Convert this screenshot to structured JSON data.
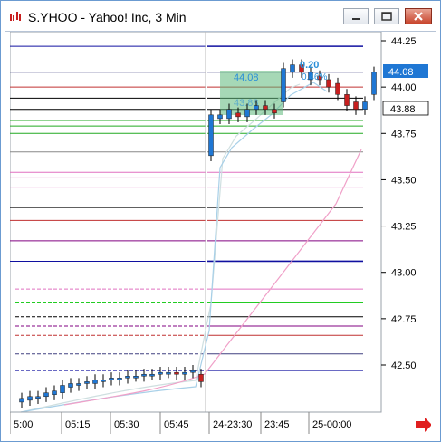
{
  "window": {
    "title": "S.YHOO - Yahoo! Inc, 3 Min"
  },
  "price_axis": {
    "ticks": [
      "44.25",
      "44.00",
      "43.75",
      "43.50",
      "43.25",
      "43.00",
      "42.75",
      "42.50"
    ],
    "last_price": "44.08",
    "bid_price": "43.88"
  },
  "time_axis": {
    "labels": [
      "5:00",
      "05:15",
      "05:30",
      "05:45",
      "24-23:30",
      "23:45",
      "25-00:00"
    ]
  },
  "annotations": {
    "box_price": "44.08",
    "box_price2": "43.88",
    "tooltip_value": "0.20",
    "tooltip_pct": "0.46%"
  },
  "colors": {
    "up_candle": "#1f77d4",
    "down_candle": "#c82020",
    "highlight_box": "#5cb87a",
    "last_price_badge": "#1f77d4"
  },
  "chart_data": {
    "type": "candlestick",
    "instrument": "S.YHOO",
    "interval": "3 Min",
    "ylim": [
      42.32,
      44.28
    ],
    "candles_left": [
      {
        "o": 42.3,
        "c": 42.32
      },
      {
        "o": 42.31,
        "c": 42.33
      },
      {
        "o": 42.32,
        "c": 42.33
      },
      {
        "o": 42.33,
        "c": 42.35
      },
      {
        "o": 42.34,
        "c": 42.36
      },
      {
        "o": 42.35,
        "c": 42.39
      },
      {
        "o": 42.38,
        "c": 42.4
      },
      {
        "o": 42.39,
        "c": 42.4
      },
      {
        "o": 42.4,
        "c": 42.41
      },
      {
        "o": 42.4,
        "c": 42.42
      },
      {
        "o": 42.41,
        "c": 42.42
      },
      {
        "o": 42.42,
        "c": 42.43
      },
      {
        "o": 42.42,
        "c": 42.43
      },
      {
        "o": 42.43,
        "c": 42.44
      },
      {
        "o": 42.44,
        "c": 42.44
      },
      {
        "o": 42.44,
        "c": 42.45
      },
      {
        "o": 42.45,
        "c": 42.45
      },
      {
        "o": 42.45,
        "c": 42.46
      },
      {
        "o": 42.46,
        "c": 42.46
      },
      {
        "o": 42.46,
        "c": 42.45
      },
      {
        "o": 42.45,
        "c": 42.46
      },
      {
        "o": 42.46,
        "c": 42.47
      },
      {
        "o": 42.45,
        "c": 42.41
      }
    ],
    "candles_right": [
      {
        "o": 43.63,
        "c": 43.85
      },
      {
        "o": 43.83,
        "c": 43.85
      },
      {
        "o": 43.83,
        "c": 43.88
      },
      {
        "o": 43.86,
        "c": 43.84
      },
      {
        "o": 43.84,
        "c": 43.88
      },
      {
        "o": 43.88,
        "c": 43.9
      },
      {
        "o": 43.9,
        "c": 43.88
      },
      {
        "o": 43.88,
        "c": 43.86
      },
      {
        "o": 43.92,
        "c": 44.1
      },
      {
        "o": 44.08,
        "c": 44.12
      },
      {
        "o": 44.12,
        "c": 44.08
      },
      {
        "o": 44.04,
        "c": 44.08
      },
      {
        "o": 44.06,
        "c": 44.04
      },
      {
        "o": 44.04,
        "c": 44.0
      },
      {
        "o": 44.02,
        "c": 43.96
      },
      {
        "o": 43.96,
        "c": 43.9
      },
      {
        "o": 43.92,
        "c": 43.88
      },
      {
        "o": 43.88,
        "c": 43.92
      },
      {
        "o": 43.96,
        "c": 44.08
      }
    ],
    "horizontal_levels": [
      {
        "price": 44.22,
        "color": "#1010a0"
      },
      {
        "price": 44.08,
        "color": "#404080"
      },
      {
        "price": 44.0,
        "color": "#c03030"
      },
      {
        "price": 43.94,
        "color": "#000000"
      },
      {
        "price": 43.88,
        "color": "#000000"
      },
      {
        "price": 43.82,
        "color": "#22aa22"
      },
      {
        "price": 43.79,
        "color": "#22aa22"
      },
      {
        "price": 43.75,
        "color": "#22aa22"
      },
      {
        "price": 43.65,
        "color": "#888888"
      },
      {
        "price": 43.54,
        "color": "#e070c0"
      },
      {
        "price": 43.51,
        "color": "#e070c0"
      },
      {
        "price": 43.46,
        "color": "#e070c0"
      },
      {
        "price": 43.35,
        "color": "#000000"
      },
      {
        "price": 43.28,
        "color": "#c03030"
      },
      {
        "price": 43.17,
        "color": "#800080"
      },
      {
        "price": 43.06,
        "color": "#1010a0"
      }
    ],
    "left_levels": [
      {
        "price": 42.91,
        "color": "#e070c0"
      },
      {
        "price": 42.84,
        "color": "#22cc22"
      },
      {
        "price": 42.76,
        "color": "#000000"
      },
      {
        "price": 42.71,
        "color": "#800080"
      },
      {
        "price": 42.66,
        "color": "#c03030"
      },
      {
        "price": 42.56,
        "color": "#404080"
      },
      {
        "price": 42.47,
        "color": "#1010a0"
      }
    ]
  }
}
